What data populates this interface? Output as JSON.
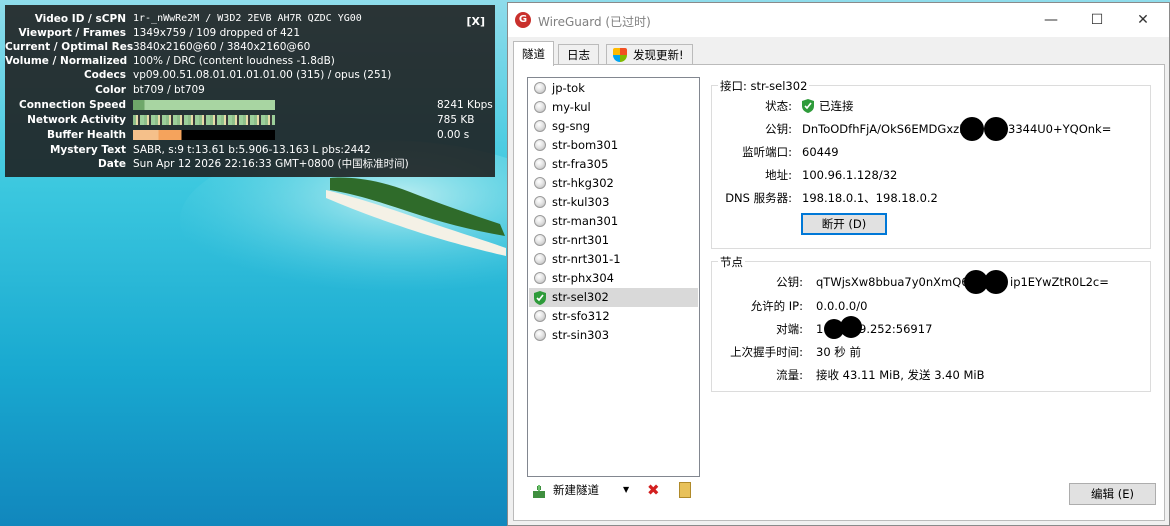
{
  "stats": {
    "close_label": "[X]",
    "rows": {
      "video_id": {
        "label": "Video ID / sCPN",
        "value": "1r-_nWwRe2M / W3D2 2EVB AH7R QZDC YG00"
      },
      "viewport": {
        "label": "Viewport / Frames",
        "value": "1349x759 / 109 dropped of 421"
      },
      "resolution": {
        "label": "Current / Optimal Res",
        "value": "3840x2160@60 / 3840x2160@60"
      },
      "volume": {
        "label": "Volume / Normalized",
        "value": "100% / DRC (content loudness -1.8dB)"
      },
      "codecs": {
        "label": "Codecs",
        "value": "vp09.00.51.08.01.01.01.01.00 (315) / opus (251)"
      },
      "color": {
        "label": "Color",
        "value": "bt709 / bt709"
      },
      "connection": {
        "label": "Connection Speed",
        "value": "8241 Kbps"
      },
      "network": {
        "label": "Network Activity",
        "value": "785 KB"
      },
      "buffer": {
        "label": "Buffer Health",
        "value": "0.00 s"
      },
      "mystery": {
        "label": "Mystery Text",
        "value": "SABR, s:9 t:13.61 b:5.906-13.163 L pbs:2442"
      },
      "date": {
        "label": "Date",
        "value": "Sun Apr 12 2026 22:16:33 GMT+0800 (中国标准时间)"
      }
    },
    "colors": {
      "connection_bar": "#a8d5a2",
      "network_bar": "#8fbf8a",
      "buffer_bar": "#f5a35c"
    }
  },
  "window": {
    "app_icon": "wireguard-icon",
    "title": "WireGuard (已过时)",
    "controls": {
      "minimize": "—",
      "maximize": "☐",
      "close": "✕"
    },
    "tabs": [
      {
        "label": "隧道",
        "active": true
      },
      {
        "label": "日志",
        "active": false
      },
      {
        "label": "发现更新!",
        "active": false,
        "icon": "shield-icon"
      }
    ],
    "tunnels": [
      {
        "name": "jp-tok",
        "active": false
      },
      {
        "name": "my-kul",
        "active": false
      },
      {
        "name": "sg-sng",
        "active": false
      },
      {
        "name": "str-bom301",
        "active": false
      },
      {
        "name": "str-fra305",
        "active": false
      },
      {
        "name": "str-hkg302",
        "active": false
      },
      {
        "name": "str-kul303",
        "active": false
      },
      {
        "name": "str-man301",
        "active": false
      },
      {
        "name": "str-nrt301",
        "active": false
      },
      {
        "name": "str-nrt301-1",
        "active": false
      },
      {
        "name": "str-phx304",
        "active": false
      },
      {
        "name": "str-sel302",
        "active": true
      },
      {
        "name": "str-sfo312",
        "active": false
      },
      {
        "name": "str-sin303",
        "active": false
      }
    ],
    "toolbar": {
      "new_tunnel": "新建隧道",
      "dropdown": "▼",
      "delete": "✖",
      "export": "zip"
    },
    "interface": {
      "title": "接口: str-sel302",
      "status_label": "状态:",
      "status_value": "已连接",
      "pubkey_label": "公钥:",
      "pubkey_value": "DnToODfhFjA/OkS6EMDGxzN",
      "pubkey_tail": "3344U0+YQOnk=",
      "port_label": "监听端口:",
      "port_value": "60449",
      "address_label": "地址:",
      "address_value": "100.96.1.128/32",
      "dns_label": "DNS 服务器:",
      "dns_value": "198.18.0.1、198.18.0.2",
      "disconnect_button": "断开 (D)"
    },
    "peer": {
      "title": "节点",
      "pubkey_label": "公钥:",
      "pubkey_value": "qTWjsXw8bbua7y0nXmQ6t",
      "pubkey_tail": "ip1EYwZtR0L2c=",
      "allowed_label": "允许的 IP:",
      "allowed_value": "0.0.0.0/0",
      "endpoint_label": "对端:",
      "endpoint_value": "1",
      "endpoint_tail": "9.252:56917",
      "handshake_label": "上次握手时间:",
      "handshake_value": "30 秒 前",
      "transfer_label": "流量:",
      "transfer_value": "接收 43.11 MiB, 发送 3.40 MiB"
    },
    "edit_button": "编辑 (E)"
  }
}
